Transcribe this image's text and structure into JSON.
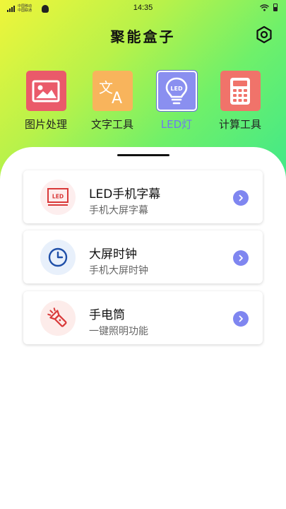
{
  "status_bar": {
    "carrier_line1": "中国移动",
    "carrier_line2": "中国联通",
    "time": "14:35"
  },
  "header": {
    "title": "聚能盒子",
    "settings_icon": "hexagon-settings-icon"
  },
  "tools": [
    {
      "label": "图片处理",
      "icon": "image-icon",
      "color": "#ea5a6a",
      "active": false
    },
    {
      "label": "文字工具",
      "icon": "translate-icon",
      "color": "#f8b45c",
      "active": false
    },
    {
      "label": "LED灯",
      "icon": "led-bulb-icon",
      "color": "#8a8ff0",
      "active": true
    },
    {
      "label": "计算工具",
      "icon": "calculator-icon",
      "color": "#f0736a",
      "active": false
    }
  ],
  "cards": [
    {
      "title": "LED手机字幕",
      "subtitle": "手机大屏字幕",
      "icon": "led-screen-icon",
      "icon_bg": "#fdeeee"
    },
    {
      "title": "大屏时钟",
      "subtitle": "手机大屏时钟",
      "icon": "clock-icon",
      "icon_bg": "#e8f0fb"
    },
    {
      "title": "手电筒",
      "subtitle": "一键照明功能",
      "icon": "flashlight-icon",
      "icon_bg": "#fdecea"
    }
  ],
  "colors": {
    "accent": "#7f86f0",
    "active_tab": "#6f79f0"
  }
}
